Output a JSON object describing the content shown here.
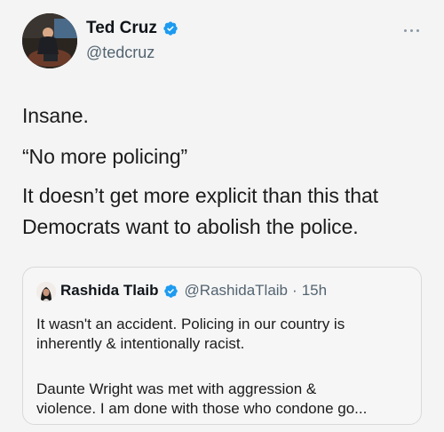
{
  "tweet": {
    "author": {
      "name": "Ted Cruz",
      "handle": "@tedcruz"
    },
    "body": {
      "line1": "Insane.",
      "line2": "“No more policing”",
      "line3": "It doesn’t get more explicit than this that",
      "line4": "Democrats want to abolish the police."
    },
    "quoted": {
      "name": "Rashida Tlaib",
      "handle": "@RashidaTlaib",
      "separator": "·",
      "time": "15h",
      "line1": "It wasn't an accident. Policing in our country is",
      "line2": "inherently & intentionally racist.",
      "line3": "Daunte Wright was met with aggression &",
      "line4": "violence. I am done with those who condone go..."
    }
  },
  "colors": {
    "verified": "#1d9bf0",
    "text": "#0f1419",
    "secondary": "#536471",
    "background": "#f4f4f4"
  },
  "icons": {
    "verified": "verified-badge-icon",
    "more": "more-dots-icon"
  }
}
